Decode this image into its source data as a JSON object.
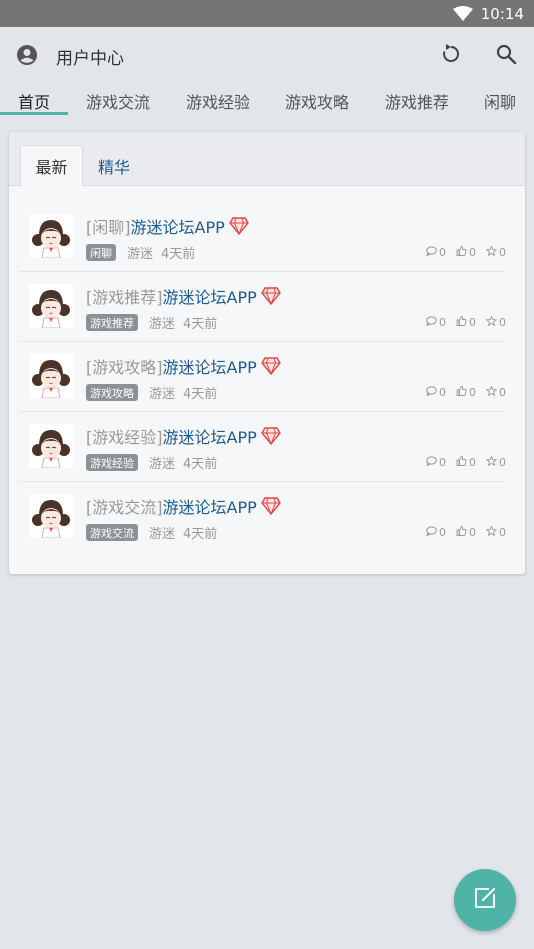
{
  "status_bar": {
    "time": "10:14",
    "wifi_icon": "wifi-icon"
  },
  "app_bar": {
    "title": "用户中心",
    "user_icon": "account-circle-icon",
    "refresh_icon": "refresh-icon",
    "search_icon": "search-icon"
  },
  "tabs": [
    {
      "label": "首页",
      "active": true
    },
    {
      "label": "游戏交流"
    },
    {
      "label": "游戏经验"
    },
    {
      "label": "游戏攻略"
    },
    {
      "label": "游戏推荐"
    },
    {
      "label": "闲聊"
    }
  ],
  "sub_tabs": [
    {
      "label": "最新",
      "active": true
    },
    {
      "label": "精华"
    }
  ],
  "posts": [
    {
      "category": "[闲聊]",
      "title": "游迷论坛APP",
      "tag": "闲聊",
      "author": "游迷",
      "time": "4天前",
      "comments": "0",
      "likes": "0",
      "favorites": "0"
    },
    {
      "category": "[游戏推荐]",
      "title": "游迷论坛APP",
      "tag": "游戏推荐",
      "author": "游迷",
      "time": "4天前",
      "comments": "0",
      "likes": "0",
      "favorites": "0"
    },
    {
      "category": "[游戏攻略]",
      "title": "游迷论坛APP",
      "tag": "游戏攻略",
      "author": "游迷",
      "time": "4天前",
      "comments": "0",
      "likes": "0",
      "favorites": "0"
    },
    {
      "category": "[游戏经验]",
      "title": "游迷论坛APP",
      "tag": "游戏经验",
      "author": "游迷",
      "time": "4天前",
      "comments": "0",
      "likes": "0",
      "favorites": "0"
    },
    {
      "category": "[游戏交流]",
      "title": "游迷论坛APP",
      "tag": "游戏交流",
      "author": "游迷",
      "time": "4天前",
      "comments": "0",
      "likes": "0",
      "favorites": "0"
    }
  ],
  "fab": {
    "icon": "edit-icon"
  },
  "colors": {
    "accent": "#4fb3a8",
    "link": "#1e5a8f",
    "background": "#e2e5e9",
    "status_bar": "#757575"
  }
}
